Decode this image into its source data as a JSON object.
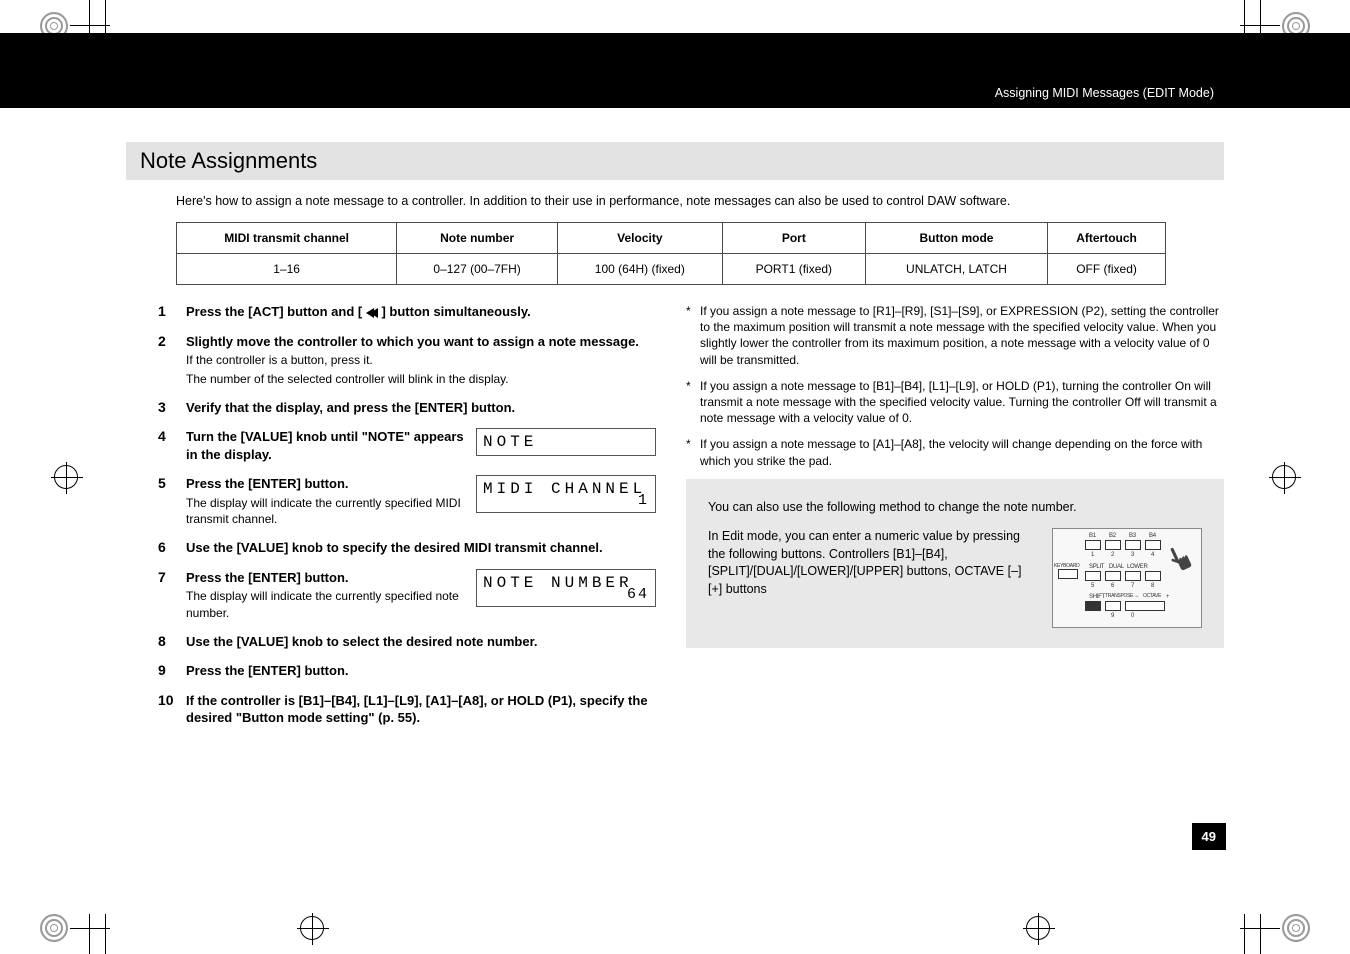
{
  "header": {
    "breadcrumb": "Assigning MIDI Messages (EDIT Mode)"
  },
  "section_title": "Note Assignments",
  "intro": "Here's how to assign a note message to a controller. In addition to their use in performance, note messages can also be used to control DAW software.",
  "table": {
    "headers": [
      "MIDI transmit channel",
      "Note number",
      "Velocity",
      "Port",
      "Button mode",
      "Aftertouch"
    ],
    "row": [
      "1–16",
      "0–127 (00–7FH)",
      "100 (64H) (fixed)",
      "PORT1 (fixed)",
      "UNLATCH, LATCH",
      "OFF (fixed)"
    ]
  },
  "steps": [
    {
      "title_a": "Press the [ACT] button and [",
      "title_b": "] button simultaneously."
    },
    {
      "title": "Slightly move the controller to which you want to assign a note message.",
      "sub1": "If the controller is a button, press it.",
      "sub2": "The number of the selected controller will blink in the display."
    },
    {
      "title": "Verify that the display, and press the [ENTER] button."
    },
    {
      "title": "Turn the [VALUE] knob until \"NOTE\" appears in the display.",
      "lcd": "NOTE"
    },
    {
      "title": "Press the [ENTER] button.",
      "sub": "The display will indicate the currently specified MIDI transmit channel.",
      "lcd": "MIDI CHANNEL",
      "lcd_val": "1"
    },
    {
      "title": "Use the [VALUE] knob to specify the desired MIDI transmit channel."
    },
    {
      "title": "Press the [ENTER] button.",
      "sub": "The display will indicate the currently specified note number.",
      "lcd": "NOTE NUMBER",
      "lcd_val": "64"
    },
    {
      "title": "Use the [VALUE] knob to select the desired note number."
    },
    {
      "title": "Press the [ENTER] button."
    },
    {
      "title": "If the controller is [B1]–[B4], [L1]–[L9], [A1]–[A8], or HOLD (P1), specify the desired  \"Button mode setting\" (p. 55)."
    }
  ],
  "notes": [
    "If you assign a note message to [R1]–[R9], [S1]–[S9], or EXPRESSION (P2), setting the controller to the maximum position will transmit a note message with the specified velocity value. When you slightly lower the controller from its maximum position, a note message with a velocity value of 0 will be transmitted.",
    "If you assign a note message to [B1]–[B4], [L1]–[L9], or HOLD (P1), turning the controller On will transmit a note message with the specified velocity value. Turning the controller Off will transmit a note message with a velocity value of 0.",
    "If you assign a note message to [A1]–[A8], the velocity will change depending on the force with which you strike the pad."
  ],
  "info_box": {
    "line1": "You can also use the following method to change the note number.",
    "line2": "In Edit mode, you can enter a numeric value by pressing the following buttons. Controllers [B1]–[B4], [SPLIT]/[DUAL]/[LOWER]/[UPPER] buttons, OCTAVE [–] [+] buttons"
  },
  "diagram_labels": {
    "b1": "B1",
    "b2": "B2",
    "b3": "B3",
    "b4": "B4",
    "keyboard": "KEYBOARD",
    "split": "SPLIT",
    "dual": "DUAL",
    "lower": "LOWER",
    "shift": "SHIFT",
    "transpose": "TRANSPOSE",
    "octave": "OCTAVE",
    "minus": "−",
    "plus": "+",
    "n1": "1",
    "n2": "2",
    "n3": "3",
    "n4": "4",
    "n5": "5",
    "n6": "6",
    "n7": "7",
    "n8": "8",
    "n9": "9",
    "n0": "0"
  },
  "page_number": "49"
}
